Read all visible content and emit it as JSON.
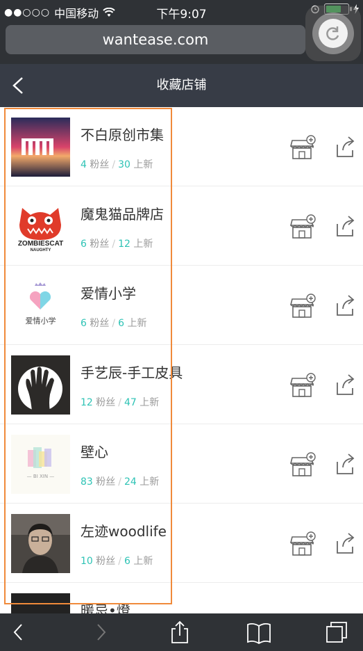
{
  "status_bar": {
    "carrier": "中国移动",
    "signal": "●●○○○",
    "time": "下午9:07"
  },
  "browser": {
    "url": "wantease.com"
  },
  "header": {
    "title": "收藏店铺"
  },
  "shops": [
    {
      "name": "不白原创市集",
      "fans": "4",
      "fans_label": "粉丝",
      "new": "30",
      "new_label": "上新"
    },
    {
      "name": "魔鬼猫品牌店",
      "fans": "6",
      "fans_label": "粉丝",
      "new": "12",
      "new_label": "上新",
      "logo_text": "ZOMBIESCAT",
      "logo_sub": "NAUGHTY"
    },
    {
      "name": "爱情小学",
      "fans": "6",
      "fans_label": "粉丝",
      "new": "6",
      "new_label": "上新",
      "logo_text": "爱情小学"
    },
    {
      "name": "手艺辰-手工皮具",
      "fans": "12",
      "fans_label": "粉丝",
      "new": "47",
      "new_label": "上新"
    },
    {
      "name": "壁心",
      "fans": "83",
      "fans_label": "粉丝",
      "new": "24",
      "new_label": "上新",
      "logo_text": "— BI XIN —"
    },
    {
      "name": "左迹woodlife",
      "fans": "10",
      "fans_label": "粉丝",
      "new": "6",
      "new_label": "上新"
    },
    {
      "name": "暖忌•燈"
    }
  ],
  "colors": {
    "accent": "#2ec3b5",
    "nav_bg": "#373c46",
    "highlight": "#f08a3a"
  }
}
